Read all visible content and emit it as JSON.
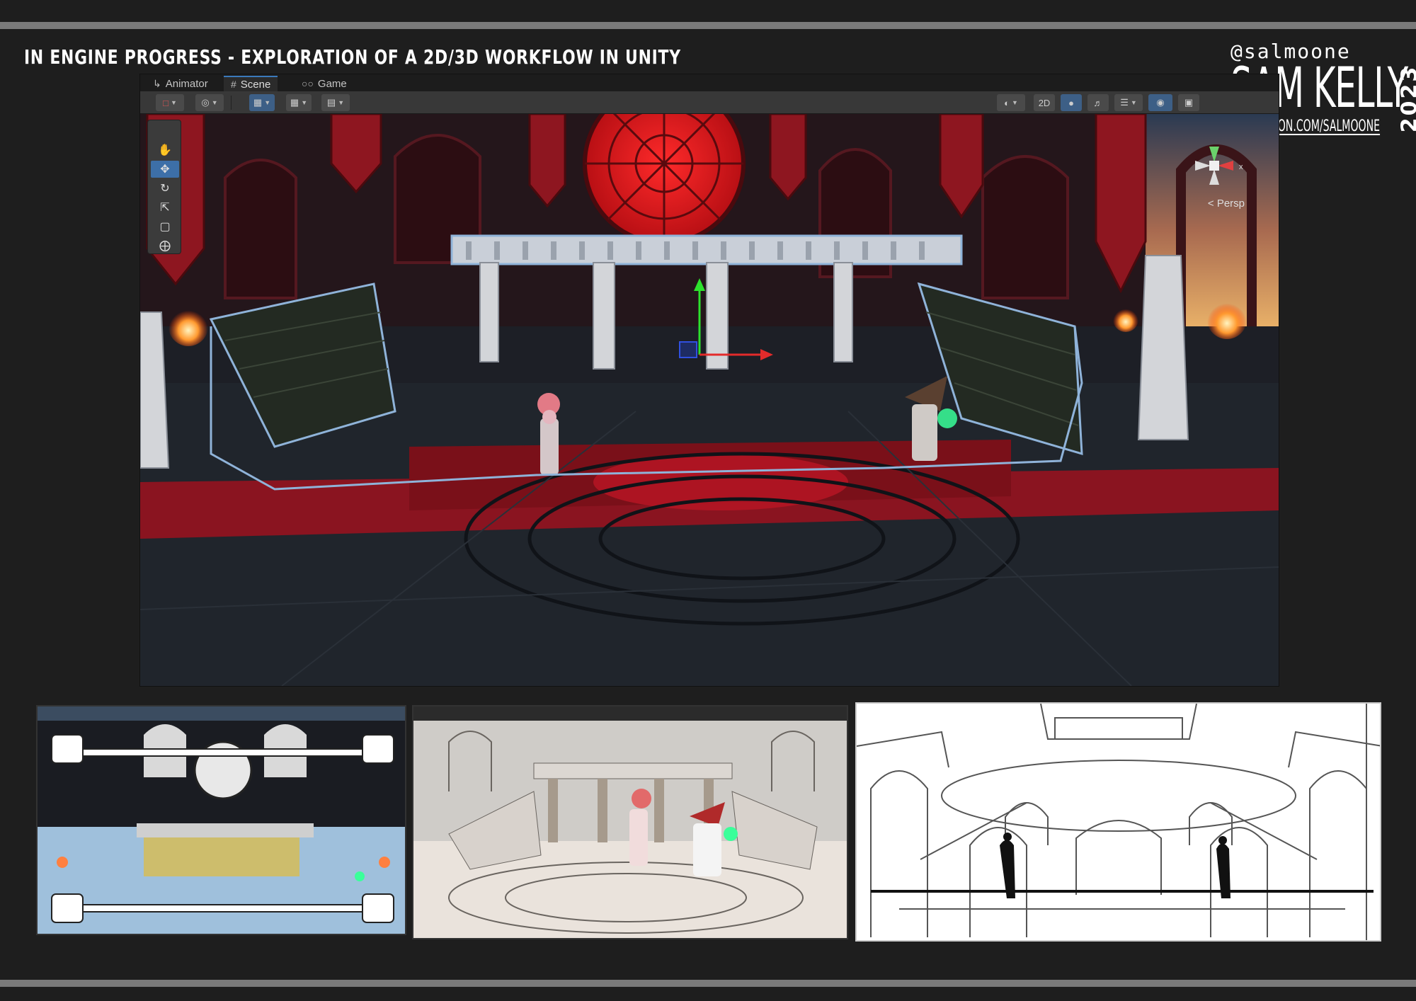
{
  "page": {
    "title": "IN ENGINE PROGRESS - EXPLORATION OF A 2D/3D WORKFLOW IN UNITY"
  },
  "branding": {
    "handle": "@salmoone",
    "name": "SAM KELLY",
    "url": "ARTSTATION.COM/SALMOONE",
    "year": "2023"
  },
  "unity": {
    "tabs": [
      {
        "label": "Animator",
        "icon": "animator-icon",
        "active": false
      },
      {
        "label": "Scene",
        "icon": "scene-grid-icon",
        "active": true
      },
      {
        "label": "Game",
        "icon": "gamepad-icon",
        "active": false
      }
    ],
    "toolbar": {
      "toggle_2d_label": "2D"
    },
    "tools": [
      "hand-tool",
      "move-tool",
      "rotate-tool",
      "scale-tool",
      "rect-tool",
      "transform-tool"
    ],
    "selected_tool": "move-tool",
    "gizmo": {
      "x_label": "x",
      "view_mode": "Persp"
    }
  },
  "thumbnails": [
    {
      "name": "game-view-2d-overlay"
    },
    {
      "name": "game-view-unlit-render"
    },
    {
      "name": "layout-sketch"
    }
  ],
  "colors": {
    "background": "#1e1e1e",
    "band": "#7a7a7a",
    "unity_toolbar": "#383838",
    "unity_selected": "#3d6fa8",
    "carpet_red": "#8a1420",
    "window_red": "#d0131b"
  }
}
